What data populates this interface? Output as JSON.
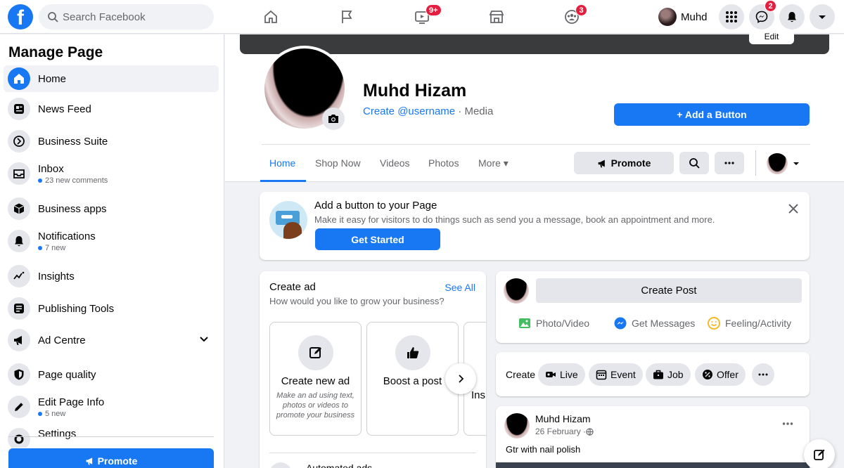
{
  "search": {
    "placeholder": "Search Facebook"
  },
  "nav": {
    "watch_badge": "9+",
    "groups_badge": "3",
    "profile_name": "Muhd",
    "messenger_badge": "2"
  },
  "sidebar": {
    "title": "Manage Page",
    "items": [
      {
        "label": "Home",
        "sub": ""
      },
      {
        "label": "News Feed",
        "sub": ""
      },
      {
        "label": "Business Suite",
        "sub": ""
      },
      {
        "label": "Inbox",
        "sub": "23 new comments"
      },
      {
        "label": "Business apps",
        "sub": ""
      },
      {
        "label": "Notifications",
        "sub": "7 new"
      },
      {
        "label": "Insights",
        "sub": ""
      },
      {
        "label": "Publishing Tools",
        "sub": ""
      },
      {
        "label": "Ad Centre",
        "sub": ""
      },
      {
        "label": "Page quality",
        "sub": ""
      },
      {
        "label": "Edit Page Info",
        "sub": "5 new"
      },
      {
        "label": "Settings",
        "sub": ""
      }
    ],
    "promote_label": "Promote"
  },
  "page_header": {
    "edit_cover": "Edit",
    "name": "Muhd Hizam",
    "username_link": "Create @username",
    "category": " · Media",
    "add_button_label": "+ Add a Button"
  },
  "tabs": [
    "Home",
    "Shop Now",
    "Videos",
    "Photos",
    "More ▾"
  ],
  "header_actions": {
    "promote": "Promote"
  },
  "add_button_card": {
    "title": "Add a button to your Page",
    "description": "Make it easy for visitors to do things such as send you a message, book an appointment and more.",
    "cta": "Get Started"
  },
  "create_ad": {
    "title": "Create ad",
    "see_all": "See All",
    "subtitle": "How would you like to grow your business?",
    "tiles": [
      {
        "title": "Create new ad",
        "desc": "Make an ad using text, photos or videos to promote your business"
      },
      {
        "title": "Boost a post",
        "desc": ""
      },
      {
        "title": "Ins",
        "desc": ""
      }
    ],
    "bottom_text": "Automated ads"
  },
  "composer": {
    "create_post": "Create Post",
    "actions": [
      "Photo/Video",
      "Get Messages",
      "Feeling/Activity"
    ]
  },
  "create_bar": {
    "label": "Create",
    "pills": [
      "Live",
      "Event",
      "Job",
      "Offer"
    ]
  },
  "post": {
    "author": "Muhd Hizam",
    "date": "26 February · ",
    "text": "Gtr with nail polish"
  },
  "colors": {
    "brand": "#1877f2",
    "badge": "#e41e3f",
    "background": "#f0f2f5"
  }
}
